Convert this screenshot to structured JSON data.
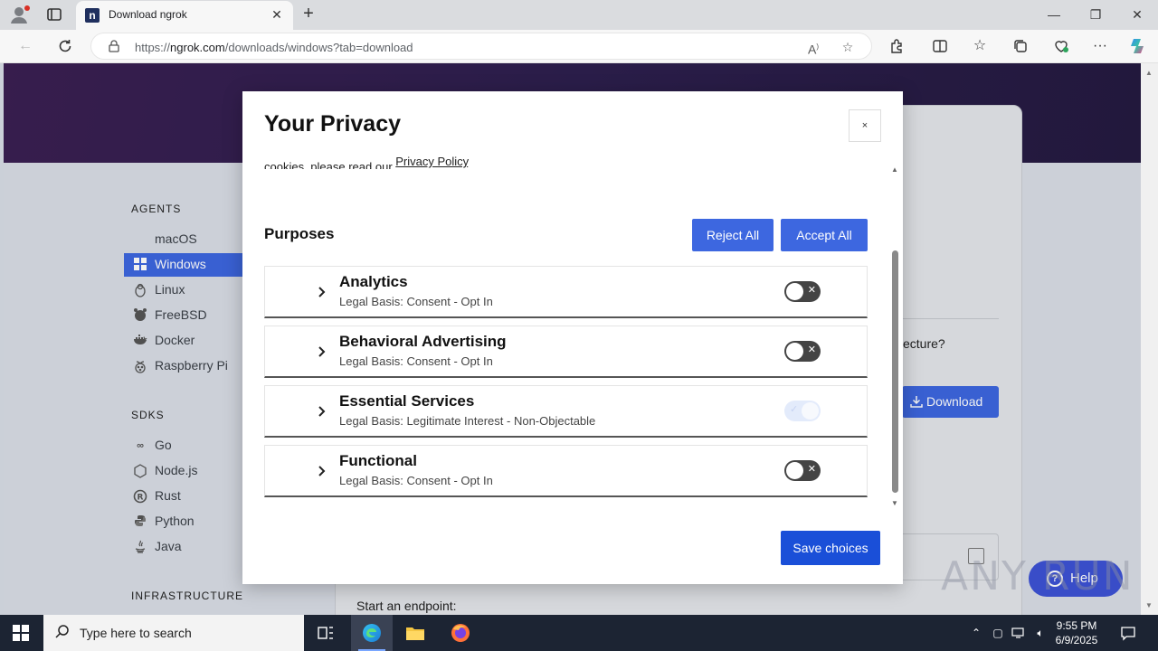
{
  "browser": {
    "tab_title": "Download ngrok",
    "tab_favicon": "n",
    "url_prefix": "https://",
    "url_domain": "ngrok.com",
    "url_path": "/downloads/windows?tab=download"
  },
  "sidebar": {
    "agents_heading": "AGENTS",
    "agents": [
      {
        "label": "macOS",
        "icon": "apple-icon"
      },
      {
        "label": "Windows",
        "icon": "windows-icon",
        "active": true
      },
      {
        "label": "Linux",
        "icon": "linux-icon"
      },
      {
        "label": "FreeBSD",
        "icon": "freebsd-icon"
      },
      {
        "label": "Docker",
        "icon": "docker-icon"
      },
      {
        "label": "Raspberry Pi",
        "icon": "raspberry-pi-icon"
      }
    ],
    "sdks_heading": "SDKS",
    "sdks": [
      {
        "label": "Go",
        "icon": "go-icon"
      },
      {
        "label": "Node.js",
        "icon": "nodejs-icon"
      },
      {
        "label": "Rust",
        "icon": "rust-icon"
      },
      {
        "label": "Python",
        "icon": "python-icon"
      },
      {
        "label": "Java",
        "icon": "java-icon"
      }
    ],
    "infrastructure_heading": "INFRASTRUCTURE"
  },
  "background": {
    "architecture_fragment": "ecture?",
    "download_label": "Download",
    "start_endpoint": "Start an endpoint:",
    "help_label": "Help"
  },
  "modal": {
    "title": "Your Privacy",
    "close_label": "×",
    "cutoff_prefix": "cookies, please read our ",
    "privacy_policy_link": "Privacy Policy",
    "cutoff_suffix": ".",
    "purposes_title": "Purposes",
    "reject_all": "Reject All",
    "accept_all": "Accept All",
    "legal_basis_label": "Legal Basis:",
    "purposes": [
      {
        "name": "Analytics",
        "basis": "Consent - Opt In",
        "enabled": false,
        "locked": false
      },
      {
        "name": "Behavioral Advertising",
        "basis": "Consent - Opt In",
        "enabled": false,
        "locked": false
      },
      {
        "name": "Essential Services",
        "basis": "Legitimate Interest - Non-Objectable",
        "enabled": true,
        "locked": true
      },
      {
        "name": "Functional",
        "basis": "Consent - Opt In",
        "enabled": false,
        "locked": false
      }
    ],
    "save_choices": "Save choices"
  },
  "watermark": "ANY RUN",
  "taskbar": {
    "search_placeholder": "Type here to search",
    "time": "9:55 PM",
    "date": "6/9/2025"
  },
  "colors": {
    "accent_blue": "#3d67e0",
    "save_blue": "#1a4fd8",
    "hero_purple": "#3b1f52",
    "taskbar": "#1c2433"
  }
}
